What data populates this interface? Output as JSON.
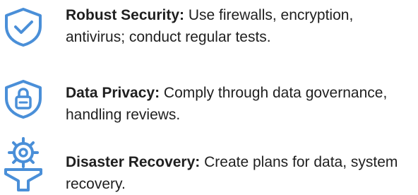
{
  "colors": {
    "icon_blue": "#4A8FD8",
    "text": "#1f1f1f"
  },
  "items": [
    {
      "icon": "shield-check-icon",
      "title": "Robust Security:",
      "description": " Use firewalls, encryption, antivirus; conduct regular tests."
    },
    {
      "icon": "shield-lock-icon",
      "title": "Data Privacy:",
      "description": " Comply through data governance, handling reviews."
    },
    {
      "icon": "gear-funnel-icon",
      "title": "Disaster Recovery:",
      "description": " Create plans for data, system recovery."
    }
  ]
}
